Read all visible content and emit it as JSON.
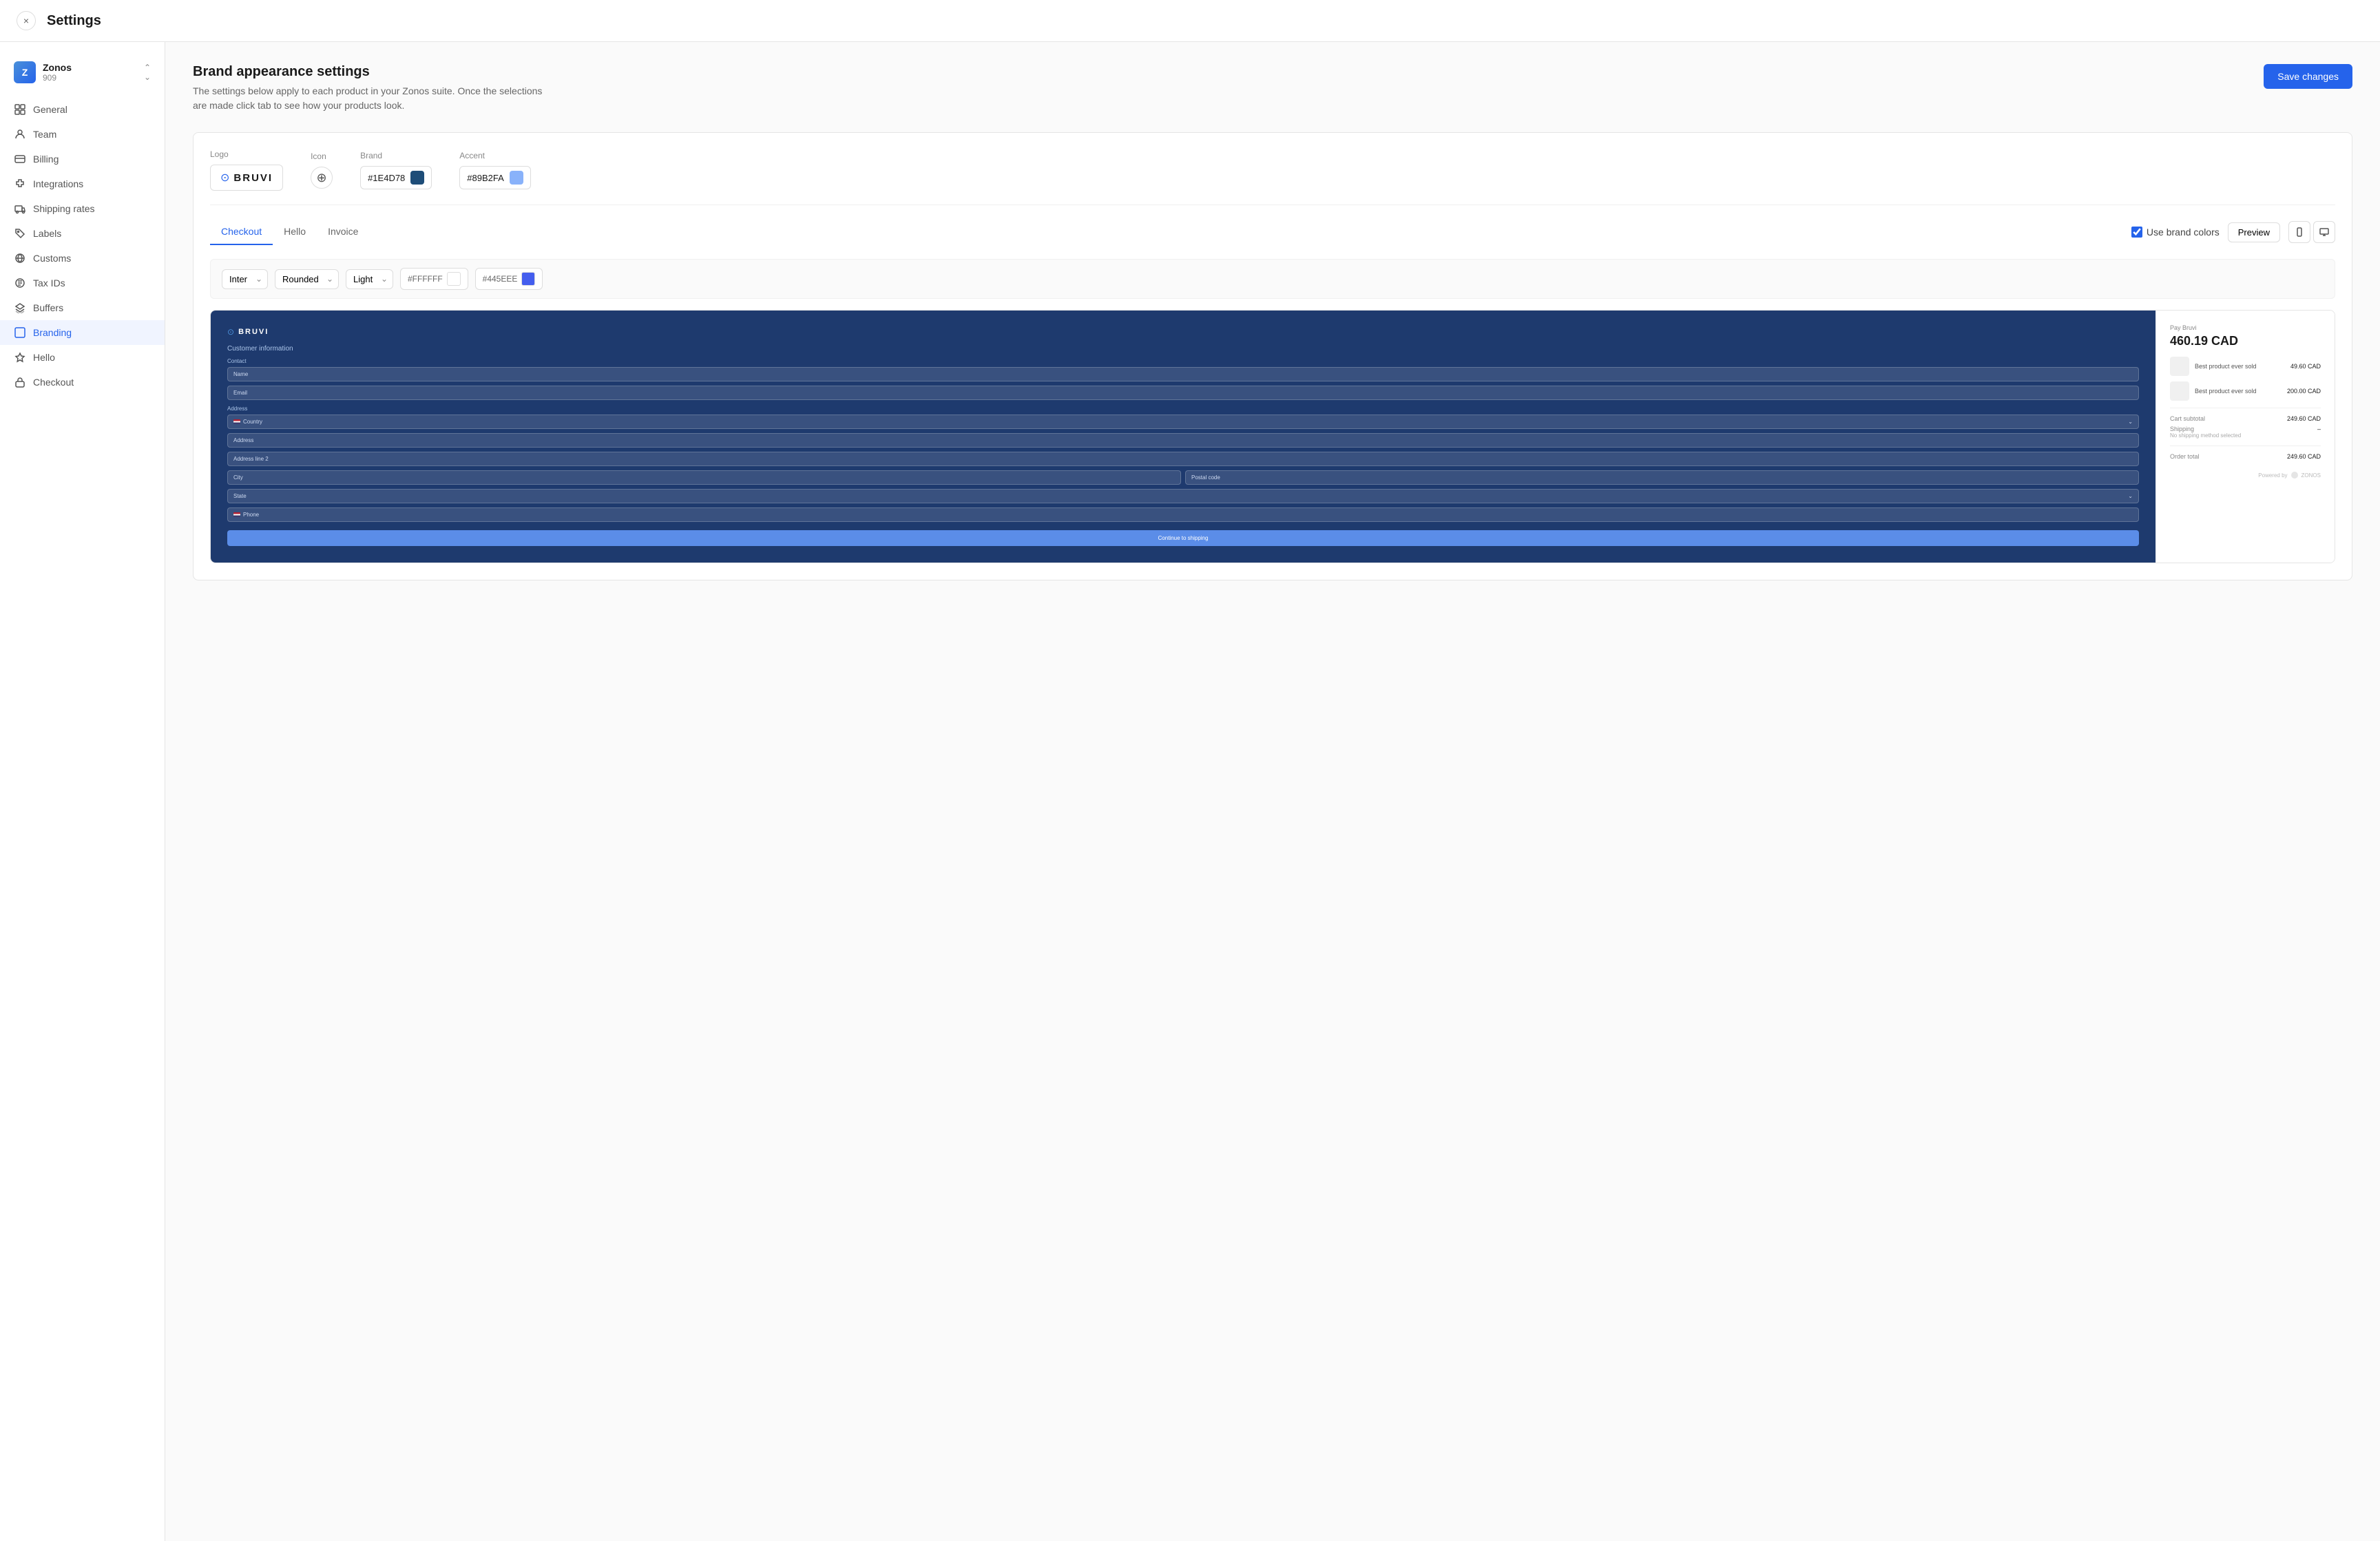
{
  "header": {
    "title": "Settings",
    "close_label": "×"
  },
  "sidebar": {
    "brand": {
      "avatar": "Z",
      "name": "Zonos",
      "sub": "909"
    },
    "nav": [
      {
        "id": "general",
        "label": "General",
        "icon": "grid"
      },
      {
        "id": "team",
        "label": "Team",
        "icon": "person"
      },
      {
        "id": "billing",
        "label": "Billing",
        "icon": "card"
      },
      {
        "id": "integrations",
        "label": "Integrations",
        "icon": "puzzle"
      },
      {
        "id": "shipping-rates",
        "label": "Shipping rates",
        "icon": "truck"
      },
      {
        "id": "labels",
        "label": "Labels",
        "icon": "tag"
      },
      {
        "id": "customs",
        "label": "Customs",
        "icon": "globe"
      },
      {
        "id": "tax-ids",
        "label": "Tax IDs",
        "icon": "globe2"
      },
      {
        "id": "buffers",
        "label": "Buffers",
        "icon": "layers"
      },
      {
        "id": "branding",
        "label": "Branding",
        "icon": "brush",
        "active": true
      },
      {
        "id": "hello",
        "label": "Hello",
        "icon": "star"
      },
      {
        "id": "checkout",
        "label": "Checkout",
        "icon": "bag"
      }
    ]
  },
  "main": {
    "title": "Brand appearance settings",
    "description": "The settings below apply to each product in your Zonos suite. Once the selections are made click tab to see how your products look.",
    "save_button": "Save changes",
    "logo_label": "Logo",
    "logo_text": "BRUVI",
    "icon_label": "Icon",
    "brand_label": "Brand",
    "brand_color": "#1E4D78",
    "accent_label": "Accent",
    "accent_color": "#89B2FA",
    "tabs": [
      {
        "id": "checkout",
        "label": "Checkout",
        "active": true
      },
      {
        "id": "hello",
        "label": "Hello"
      },
      {
        "id": "invoice",
        "label": "Invoice"
      }
    ],
    "use_brand_colors": "Use brand colors",
    "preview_button": "Preview",
    "toolbar": {
      "font": "Inter",
      "shape": "Rounded",
      "mode": "Light",
      "white_color": "#FFFFFF",
      "dark_color": "#445EEE"
    },
    "checkout_preview": {
      "logo_text": "BRUVI",
      "section_title": "Customer information",
      "contact_label": "Contact",
      "name_placeholder": "Name",
      "email_placeholder": "Email",
      "address_label": "Address",
      "country_placeholder": "Country",
      "address_placeholder": "Address",
      "address2_placeholder": "Address line 2",
      "city_placeholder": "City",
      "postal_placeholder": "Postal code",
      "state_placeholder": "State",
      "phone_placeholder": "Phone",
      "cta": "Continue to shipping"
    },
    "order_summary": {
      "pay_label": "Pay Bruvi",
      "total_amount": "460.19 CAD",
      "items": [
        {
          "name": "Best product ever sold",
          "price": "49.60 CAD"
        },
        {
          "name": "Best product ever sold",
          "price": "200.00 CAD"
        }
      ],
      "cart_subtotal_label": "Cart subtotal",
      "cart_subtotal": "249.60 CAD",
      "shipping_label": "Shipping",
      "shipping_note": "No shipping method selected",
      "shipping_value": "–",
      "order_total_label": "Order total",
      "order_total": "249.60 CAD",
      "powered_by": "Powered by",
      "powered_brand": "ZONOS"
    }
  }
}
